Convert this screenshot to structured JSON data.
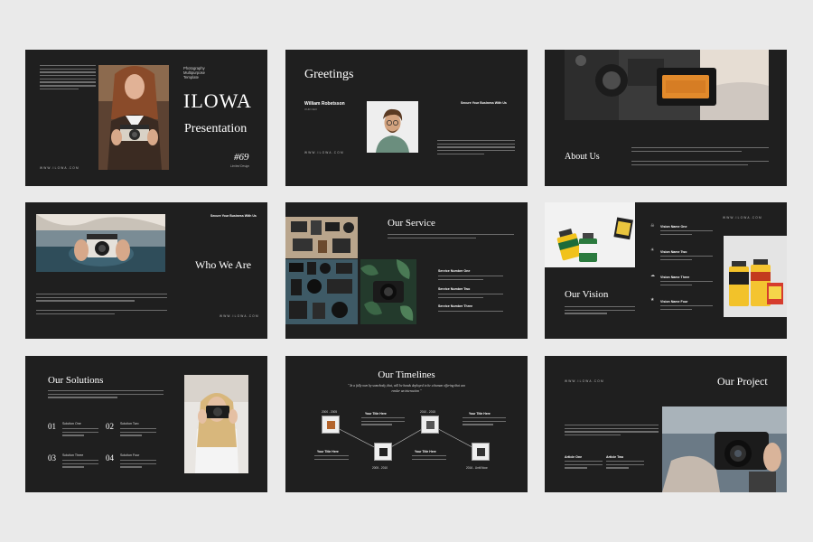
{
  "slides": {
    "s1": {
      "title_line1": "ILOWA",
      "title_line2": "Presentation",
      "category": "Photography\nMultipurpose\nTemplate",
      "number": "#69",
      "number_sub": "Limited Design",
      "url": "WWW.ILOWA.COM"
    },
    "s2": {
      "title": "Greetings",
      "person_name": "William Robetsson",
      "person_role": "OUR CEO",
      "tagline": "Secure Your Business With Us",
      "url": "WWW.ILOWA.COM"
    },
    "s3": {
      "title": "About Us"
    },
    "s4": {
      "title": "Who We Are",
      "tagline": "Secure Your Business With Us",
      "url": "WWW.ILOWA.COM"
    },
    "s5": {
      "title": "Our Service",
      "services": [
        "Service Number One",
        "Service Number Two",
        "Service Number Three"
      ]
    },
    "s6": {
      "title": "Our Vision",
      "url": "WWW.ILOWA.COM",
      "vision_items": [
        "Vision Name One",
        "Vision Name Two",
        "Vision Name Three",
        "Vision Name Four"
      ]
    },
    "s7": {
      "title": "Our Solutions",
      "solutions": [
        {
          "num": "01",
          "name": "Solution One"
        },
        {
          "num": "02",
          "name": "Solution Two"
        },
        {
          "num": "03",
          "name": "Solution Three"
        },
        {
          "num": "04",
          "name": "Solution Four"
        }
      ]
    },
    "s8": {
      "title": "Our Timelines",
      "quote": "\" In a fully own by somebody, that, will be hands deployed to be a human offering that can render an interaction \"",
      "events": [
        {
          "date": "2000 - 2005",
          "name": "Your Title Here"
        },
        {
          "date": "2005 - 2010",
          "name": "Your Title Here"
        },
        {
          "date": "2010 - 2015",
          "name": "Your Title Here"
        },
        {
          "date": "2015 - 2016",
          "name": "Your Title Here"
        },
        {
          "date": "2016 - Until Now",
          "name": "Your Title Here"
        }
      ]
    },
    "s9": {
      "title": "Our Project",
      "url": "WWW.ILOWA.COM",
      "articles": [
        "Article One",
        "Article Two"
      ]
    }
  },
  "colors": {
    "page_bg": "#eaeaea",
    "slide_bg": "#1f1f1f",
    "text": "#ffffff",
    "muted_text": "#8a8a8a",
    "accent_orange": "#e28a2b"
  }
}
